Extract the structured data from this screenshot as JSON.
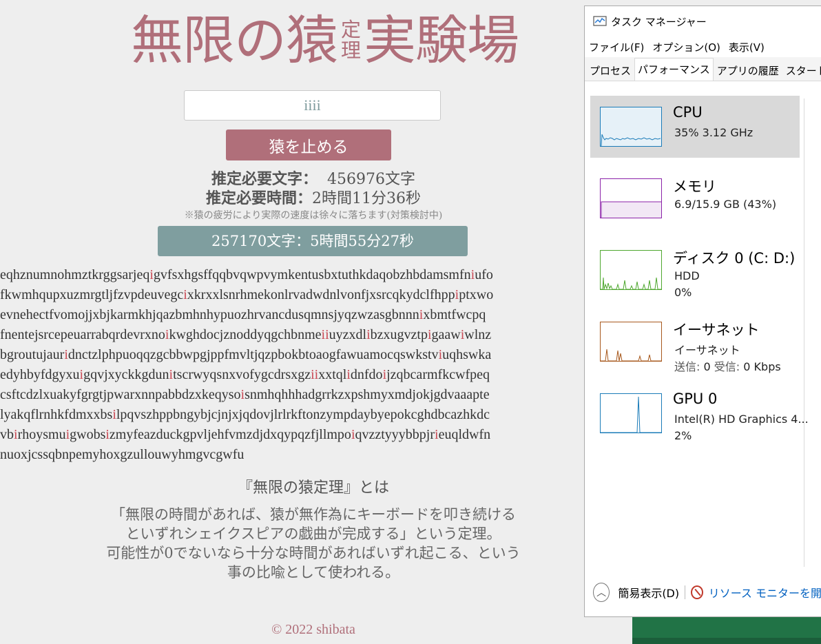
{
  "page": {
    "title_main1": "無限の猿",
    "title_ruby_top": "定",
    "title_ruby_bottom": "理",
    "title_main2": "実験場",
    "seed_input_value": "iiii",
    "stop_button_label": "猿を止める",
    "estimate_chars_label": "推定必要文字：",
    "estimate_chars_value": "456976文字",
    "estimate_time_label": "推定必要時間：",
    "estimate_time_value": "2時間11分36秒",
    "note": "※猿の疲労により実際の速度は徐々に落ちます(対策検討中)",
    "progress_text": "257170文字：5時間55分27秒",
    "typed_lines": [
      [
        [
          "eqhznumnohmztkrggsarjeq",
          0
        ],
        [
          "i",
          1
        ],
        [
          "gvfsxhgsffqqbvqwpvymkentusbxtuthkdaqobzhbdamsmfn",
          0
        ],
        [
          "i",
          1
        ],
        [
          "ufo",
          0
        ]
      ],
      [
        [
          "fkwmhqupxuzmrgtljfzvpdeuvegc",
          0
        ],
        [
          "i",
          1
        ],
        [
          "xkrxxlsnrhmekonlrvadwdnlvonfjxsrcqkydclfhpp",
          0
        ],
        [
          "i",
          1
        ],
        [
          "ptxwo",
          0
        ]
      ],
      [
        [
          "evnehectfvomojjxbjkarmkhjqazbmhnhypuozhrvancdusqmnsjyqzwzasgbnnn",
          0
        ],
        [
          "i",
          1
        ],
        [
          "xbmtfwcpq",
          0
        ]
      ],
      [
        [
          "fnentejsrcepeuarrabqrdevrxno",
          0
        ],
        [
          "i",
          1
        ],
        [
          "kwghdocjznoddyqgchbnme",
          0
        ],
        [
          "ii",
          1
        ],
        [
          "uyzxdl",
          0
        ],
        [
          "i",
          1
        ],
        [
          "bzxugvztp",
          0
        ],
        [
          "i",
          1
        ],
        [
          "gaaw",
          0
        ],
        [
          "i",
          1
        ],
        [
          "wlnz",
          0
        ]
      ],
      [
        [
          "bgroutujaur",
          0
        ],
        [
          "i",
          1
        ],
        [
          "dnctzlphpuoqqzgcbbwpgjppfmvltjqzpbokbtoaogfawuamocqswkstv",
          0
        ],
        [
          "i",
          1
        ],
        [
          "uqhswka",
          0
        ]
      ],
      [
        [
          "edyhbyfdgyxu",
          0
        ],
        [
          "i",
          1
        ],
        [
          "gqvjxyckkgdun",
          0
        ],
        [
          "i",
          1
        ],
        [
          "tscrwyqsnxvofygcdrsxgz",
          0
        ],
        [
          "ii",
          1
        ],
        [
          "xxtql",
          0
        ],
        [
          "i",
          1
        ],
        [
          "dnfdo",
          0
        ],
        [
          "i",
          1
        ],
        [
          "jzqbcarmfkcwfpeq",
          0
        ]
      ],
      [
        [
          "csftcdzlxuakyfgrgtjpwarxnnpabbdzxkeqyso",
          0
        ],
        [
          "i",
          1
        ],
        [
          "snmhqhhhadgrrkzxpshmyxmdjokjgdvaaapte",
          0
        ]
      ],
      [
        [
          "lyakqflrnhkfdmxxbs",
          0
        ],
        [
          "i",
          1
        ],
        [
          "lpqvszhppbngybjcjnjxjqdovjlrlrkftonzympdaybyepokcghdbcazhkdc",
          0
        ]
      ],
      [
        [
          "vb",
          0
        ],
        [
          "i",
          1
        ],
        [
          "rhoysmu",
          0
        ],
        [
          "i",
          1
        ],
        [
          "gwobs",
          0
        ],
        [
          "i",
          1
        ],
        [
          "zmyfeazduckgpvljehfvmzdjdxqypqzfjllmpo",
          0
        ],
        [
          "i",
          1
        ],
        [
          "qvzztyyybbpjr",
          0
        ],
        [
          "i",
          1
        ],
        [
          "euqldwfn",
          0
        ]
      ],
      [
        [
          "nuoxjcssqbnpemyhoxgzullouwyhmgvcgwfu",
          0
        ]
      ]
    ],
    "about_heading": "『無限の猿定理』とは",
    "about_lines": [
      "「無限の時間があれば、猿が無作為にキーボードを叩き続ける",
      "といずれシェイクスピアの戯曲が完成する」という定理。",
      "可能性が0でないなら十分な時間があればいずれ起こる、という",
      "事の比喩として使われる。"
    ],
    "footer": "© 2022 shibata"
  },
  "task_manager": {
    "title": "タスク マネージャー",
    "menu": [
      "ファイル(F)",
      "オプション(O)",
      "表示(V)"
    ],
    "tabs": [
      "プロセス",
      "パフォーマンス",
      "アプリの履歴",
      "スタートア"
    ],
    "active_tab": 1,
    "items": [
      {
        "name": "CPU",
        "sub1": "35%  3.12 GHz",
        "sub2": "",
        "color": "#1a7bb8",
        "fill": "#e6f1f8",
        "icon": "cpu-graph-icon"
      },
      {
        "name": "メモリ",
        "sub1": "6.9/15.9 GB (43%)",
        "sub2": "",
        "color": "#8b22a8",
        "fill": "#f2e8f5",
        "icon": "memory-graph-icon"
      },
      {
        "name": "ディスク 0 (C: D:)",
        "sub1": "HDD",
        "sub2": "0%",
        "color": "#4ea72e",
        "fill": "#ffffff",
        "icon": "disk-graph-icon"
      },
      {
        "name": "イーサネット",
        "sub1": "イーサネット",
        "sub2_send_label": "送信:",
        "sub2_send": "0",
        "sub2_recv_label": "受信:",
        "sub2_recv": "0 Kbps",
        "color": "#a7581c",
        "fill": "#ffffff",
        "icon": "ethernet-graph-icon"
      },
      {
        "name": "GPU 0",
        "sub1": "Intel(R) HD Graphics 4...",
        "sub2": "2%",
        "color": "#1a7bb8",
        "fill": "#ffffff",
        "icon": "gpu-graph-icon"
      }
    ],
    "fewer_details": "簡易表示(D)",
    "resource_monitor": "リソース モニターを開"
  }
}
